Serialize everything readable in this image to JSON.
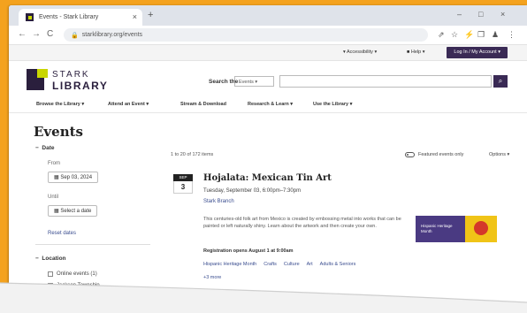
{
  "browser": {
    "tab_title": "Events - Stark Library",
    "tab_close": "×",
    "new_tab": "+",
    "window_controls": [
      "–",
      "□",
      "×"
    ],
    "url": "starklibrary.org/events",
    "nav_back": "←",
    "nav_forward": "→",
    "nav_reload": "C",
    "toolbar_icons": [
      "⇗",
      "☆",
      "⚡",
      "❐",
      "♟",
      "⋮"
    ]
  },
  "utility": {
    "accessibility": "▾ Accessibility ▾",
    "help": "■ Help ▾",
    "login": "Log In / My Account ▾"
  },
  "header": {
    "brand_line1": "STARK",
    "brand_line2": "LIBRARY",
    "search_label": "Search the",
    "search_scope": "Events ▾",
    "search_placeholder": "",
    "search_button": "⌕"
  },
  "nav": {
    "items": [
      "Browse the Library ▾",
      "Attend an Event ▾",
      "Stream & Download",
      "Research & Learn ▾",
      "Use the Library ▾"
    ]
  },
  "page": {
    "title": "Events"
  },
  "filters": {
    "date_heading": "Date",
    "from_label": "From",
    "from_value": "Sep 03, 2024",
    "until_label": "Until",
    "until_value": "Select a date",
    "reset_label": "Reset dates",
    "location_heading": "Location",
    "location_option": "Online events (1)",
    "location_option2": "Jackson Township"
  },
  "results": {
    "count": "1 to 20 of 172 items",
    "featured_label": "Featured events only",
    "options_label": "Options ▾"
  },
  "event": {
    "month": "SEP",
    "day": "3",
    "title": "Hojalata: Mexican Tin Art",
    "date": "Tuesday, September 03, 6:00pm–7:30pm",
    "location": "Stark Branch",
    "description": "This centuries-old folk art from Mexico is created by embossing metal into works that can be painted or left naturally shiny. Learn about the artwork and then create your own.",
    "registration": "Registration opens August 1 at 9:00am",
    "tags": [
      "Hispanic Heritage Month",
      "Crafts",
      "Culture",
      "Art",
      "Adults & Seniors"
    ],
    "more": "+3 more",
    "promo_text": "Hispanic Heritage Month"
  }
}
